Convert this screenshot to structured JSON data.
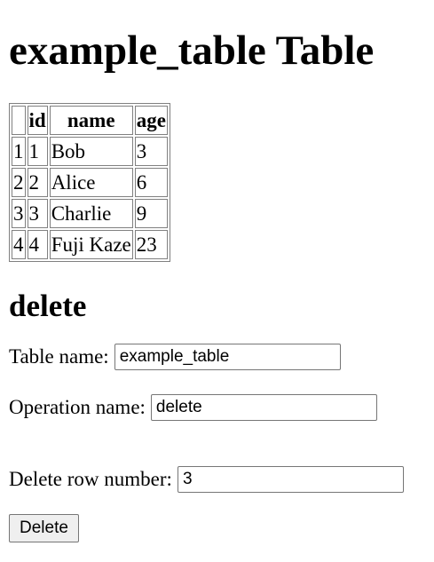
{
  "page": {
    "title": "example_table Table"
  },
  "table": {
    "columns": [
      "",
      "id",
      "name",
      "age"
    ],
    "rows": [
      [
        "1",
        "1",
        "Bob",
        "3"
      ],
      [
        "2",
        "2",
        "Alice",
        "6"
      ],
      [
        "3",
        "3",
        "Charlie",
        "9"
      ],
      [
        "4",
        "4",
        "Fuji Kaze",
        "23"
      ]
    ]
  },
  "section": {
    "title": "delete"
  },
  "form": {
    "table_name_label": "Table name:",
    "table_name_value": "example_table",
    "operation_name_label": "Operation name:",
    "operation_name_value": "delete",
    "delete_row_label": "Delete row number:",
    "delete_row_value": "3",
    "submit_label": "Delete"
  }
}
